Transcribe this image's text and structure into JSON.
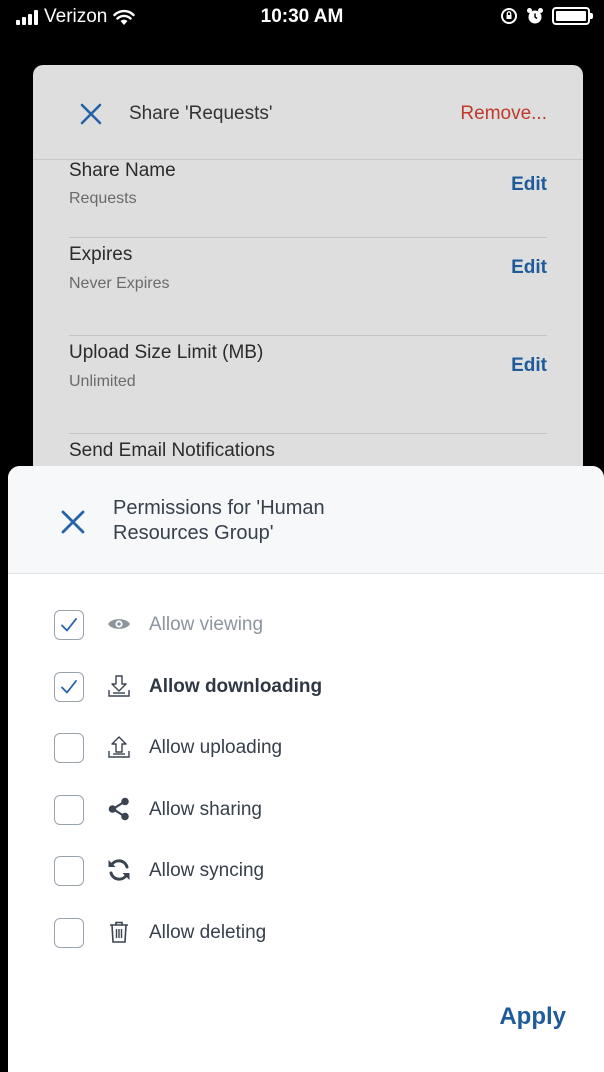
{
  "status_bar": {
    "carrier": "Verizon",
    "time": "10:30 AM"
  },
  "background_card": {
    "title": "Share 'Requests'",
    "remove_label": "Remove...",
    "rows": [
      {
        "label": "Share Name",
        "value": "Requests",
        "action": "Edit"
      },
      {
        "label": "Expires",
        "value": "Never Expires",
        "action": "Edit"
      },
      {
        "label": "Upload Size Limit (MB)",
        "value": "Unlimited",
        "action": "Edit"
      },
      {
        "label": "Send Email Notifications"
      }
    ]
  },
  "sheet": {
    "title": "Permissions for 'Human Resources Group'",
    "permissions": [
      {
        "label": "Allow viewing",
        "checked": true,
        "icon": "eye-icon"
      },
      {
        "label": "Allow downloading",
        "checked": true,
        "icon": "download-icon"
      },
      {
        "label": "Allow uploading",
        "checked": false,
        "icon": "upload-icon"
      },
      {
        "label": "Allow sharing",
        "checked": false,
        "icon": "share-icon"
      },
      {
        "label": "Allow syncing",
        "checked": false,
        "icon": "sync-icon"
      },
      {
        "label": "Allow deleting",
        "checked": false,
        "icon": "trash-icon"
      }
    ],
    "apply_label": "Apply"
  },
  "colors": {
    "accent": "#1f5b9a",
    "danger": "#c0392b"
  }
}
